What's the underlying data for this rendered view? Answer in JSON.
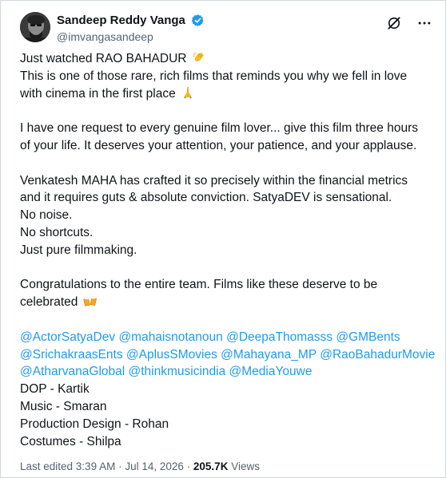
{
  "author": {
    "display_name": "Sandeep Reddy Vanga",
    "handle": "@imvangasandeep",
    "verified": true,
    "avatar_icon": "avatar-photo"
  },
  "icons": {
    "verified": "verified-badge-icon",
    "grok": "grok-icon",
    "more": "more-options-icon"
  },
  "colors": {
    "mention": "#1d9bf0",
    "verified": "#1d9bf0",
    "secondary_text": "#536471"
  },
  "tweet": {
    "lines": [
      {
        "type": "text",
        "text": "Just watched RAO BAHADUR ",
        "emoji": "clapping-hands-icon"
      },
      {
        "type": "text",
        "text": "This is one of those rare, rich films that reminds you why we fell in love"
      },
      {
        "type": "text",
        "text": "with cinema in the first place ",
        "emoji": "folded-hands-icon"
      },
      {
        "type": "gap"
      },
      {
        "type": "text",
        "text": "I have one request to every genuine film lover... give this film three hours"
      },
      {
        "type": "text",
        "text": "of your life. It deserves your attention, your patience, and your applause."
      },
      {
        "type": "gap"
      },
      {
        "type": "text",
        "text": "Venkatesh MAHA has crafted it so precisely within the financial metrics"
      },
      {
        "type": "text",
        "text": "and it requires guts & absolute conviction. SatyaDEV is sensational."
      },
      {
        "type": "text",
        "text": "No noise."
      },
      {
        "type": "text",
        "text": "No shortcuts."
      },
      {
        "type": "text",
        "text": "Just pure filmmaking."
      },
      {
        "type": "gap"
      },
      {
        "type": "text",
        "text": "Congratulations to the entire team. Films like these deserve to be"
      },
      {
        "type": "text",
        "text": "celebrated ",
        "emoji": "clinking-beer-mugs-icon"
      },
      {
        "type": "gap"
      },
      {
        "type": "mentions",
        "items": [
          "@ActorSatyaDev",
          "@mahaisnotanoun",
          "@DeepaThomasss",
          "@GMBents"
        ]
      },
      {
        "type": "mentions",
        "items": [
          "@SrichakraasEnts",
          "@AplusSMovies",
          "@Mahayana_MP",
          "@RaoBahadurMovie"
        ]
      },
      {
        "type": "mentions",
        "items": [
          "@AtharvanaGlobal",
          "@thinkmusicindia",
          "@MediaYouwe"
        ]
      },
      {
        "type": "text",
        "text": "DOP - Kartik"
      },
      {
        "type": "text",
        "text": "Music - Smaran"
      },
      {
        "type": "text",
        "text": "Production Design - Rohan"
      },
      {
        "type": "text",
        "text": "Costumes - Shilpa"
      }
    ]
  },
  "meta": {
    "edited_label": "Last edited 3:39 AM",
    "separator": " · ",
    "date": "Jul 14, 2026",
    "views_count": "205.7K",
    "views_label": " Views"
  }
}
